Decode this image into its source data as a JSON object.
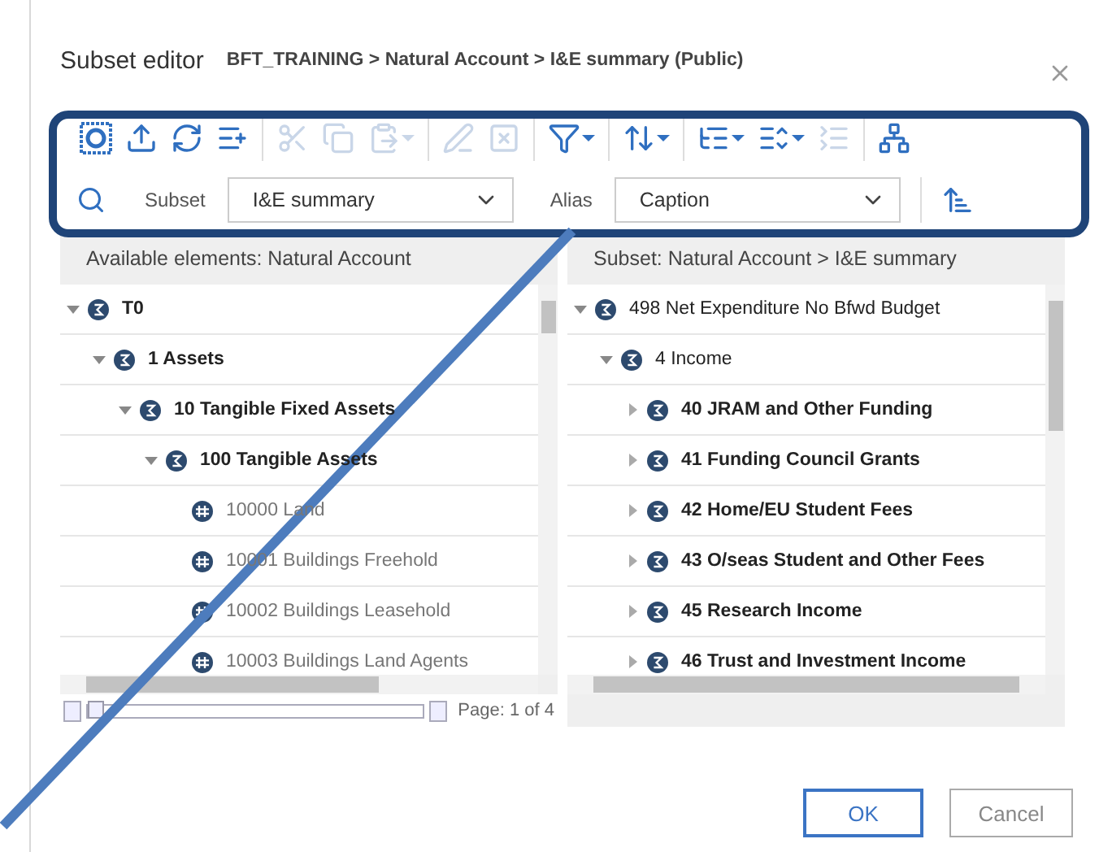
{
  "dialog": {
    "title": "Subset editor",
    "breadcrumb": "BFT_TRAINING > Natural Account > I&E summary (Public)"
  },
  "toolbar": {
    "groups": [
      [
        {
          "disabled": false,
          "dropdown": false
        },
        {
          "disabled": false,
          "dropdown": false
        },
        {
          "disabled": false,
          "dropdown": false
        },
        {
          "disabled": false,
          "dropdown": false
        }
      ],
      [
        {
          "disabled": true,
          "dropdown": false
        },
        {
          "disabled": true,
          "dropdown": false
        },
        {
          "disabled": true,
          "dropdown": true
        }
      ],
      [
        {
          "disabled": true,
          "dropdown": false
        },
        {
          "disabled": true,
          "dropdown": false
        }
      ],
      [
        {
          "disabled": false,
          "dropdown": true
        }
      ],
      [
        {
          "disabled": false,
          "dropdown": true
        }
      ],
      [
        {
          "disabled": false,
          "dropdown": true
        },
        {
          "disabled": false,
          "dropdown": true
        },
        {
          "disabled": true,
          "dropdown": false
        }
      ],
      [
        {
          "disabled": false,
          "dropdown": false
        }
      ]
    ]
  },
  "subset": {
    "label": "Subset",
    "value": "I&E summary"
  },
  "alias": {
    "label": "Alias",
    "value": "Caption"
  },
  "available": {
    "header": "Available elements: Natural Account",
    "pager": {
      "label": "Page: 1 of 4",
      "level": 0
    },
    "items": [
      {
        "label": "T0",
        "kind": "consolidated",
        "expanded": true,
        "children": [
          {
            "label": "1 Assets",
            "kind": "consolidated",
            "expanded": true,
            "children": [
              {
                "label": "10 Tangible Fixed Assets",
                "kind": "consolidated",
                "expanded": true,
                "children": [
                  {
                    "label": "100 Tangible Assets",
                    "kind": "consolidated",
                    "expanded": true,
                    "children": [
                      {
                        "label": "10000 Land",
                        "kind": "leaf"
                      },
                      {
                        "label": "10001 Buildings Freehold",
                        "kind": "leaf"
                      },
                      {
                        "label": "10002 Buildings Leasehold",
                        "kind": "leaf"
                      },
                      {
                        "label": "10003 Buildings Land Agents",
                        "kind": "leaf"
                      }
                    ]
                  }
                ]
              }
            ]
          }
        ]
      }
    ]
  },
  "subset_panel": {
    "header": "Subset: Natural Account > I&E summary",
    "items": [
      {
        "label": "498 Net Expenditure No Bfwd Budget",
        "kind": "consolidated",
        "expanded": true,
        "children": [
          {
            "label": "4 Income",
            "kind": "consolidated",
            "expanded": true,
            "children": [
              {
                "label": "40 JRAM and Other Funding",
                "kind": "consolidated",
                "expanded": false
              },
              {
                "label": "41 Funding Council Grants",
                "kind": "consolidated",
                "expanded": false
              },
              {
                "label": "42 Home/EU Student Fees",
                "kind": "consolidated",
                "expanded": false
              },
              {
                "label": "43 O/seas Student and Other Fees",
                "kind": "consolidated",
                "expanded": false
              },
              {
                "label": "45 Research Income",
                "kind": "consolidated",
                "expanded": false
              },
              {
                "label": "46 Trust and Investment Income",
                "kind": "consolidated",
                "expanded": false
              }
            ]
          }
        ]
      }
    ]
  },
  "buttons": [
    {
      "label": "OK",
      "kind": "primary"
    },
    {
      "label": "Cancel",
      "kind": "secondary"
    }
  ]
}
